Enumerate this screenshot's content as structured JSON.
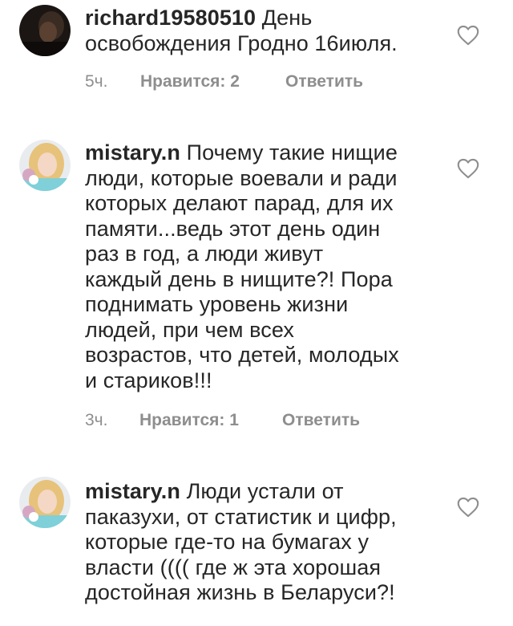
{
  "comments": [
    {
      "username": "richard19580510",
      "lines": [
        "День",
        "освобождения Гродно 16июля."
      ],
      "time": "5ч.",
      "likes": "Нравится: 2",
      "reply": "Ответить",
      "avatar": "dark-avatar"
    },
    {
      "username": "mistary.n",
      "lines": [
        "Почему такие нищие",
        "люди, которые воевали и ради",
        "которых делают парад, для их",
        "памяти...ведь этот день один",
        "раз в год, а люди живут",
        "каждый день в нищите?! Пора",
        "поднимать уровень жизни",
        "людей, при чем всех",
        "возрастов, что детей, молодых",
        "и стариков!!!"
      ],
      "time": "3ч.",
      "likes": "Нравится: 1",
      "reply": "Ответить",
      "avatar": "blonde-woman-avatar"
    },
    {
      "username": "mistary.n",
      "lines": [
        "Люди устали от",
        "паказухи, от статистик и цифр,",
        "которые где-то на бумагах у",
        "власти (((( где ж эта хорошая",
        "достойная жизнь в Беларуси?!"
      ],
      "avatar": "blonde-woman-avatar"
    }
  ],
  "colors": {
    "text": "#262626",
    "meta": "#8e8e8e",
    "heart": "#8e8e8e"
  },
  "icons": {
    "like": "heart-outline-icon"
  }
}
